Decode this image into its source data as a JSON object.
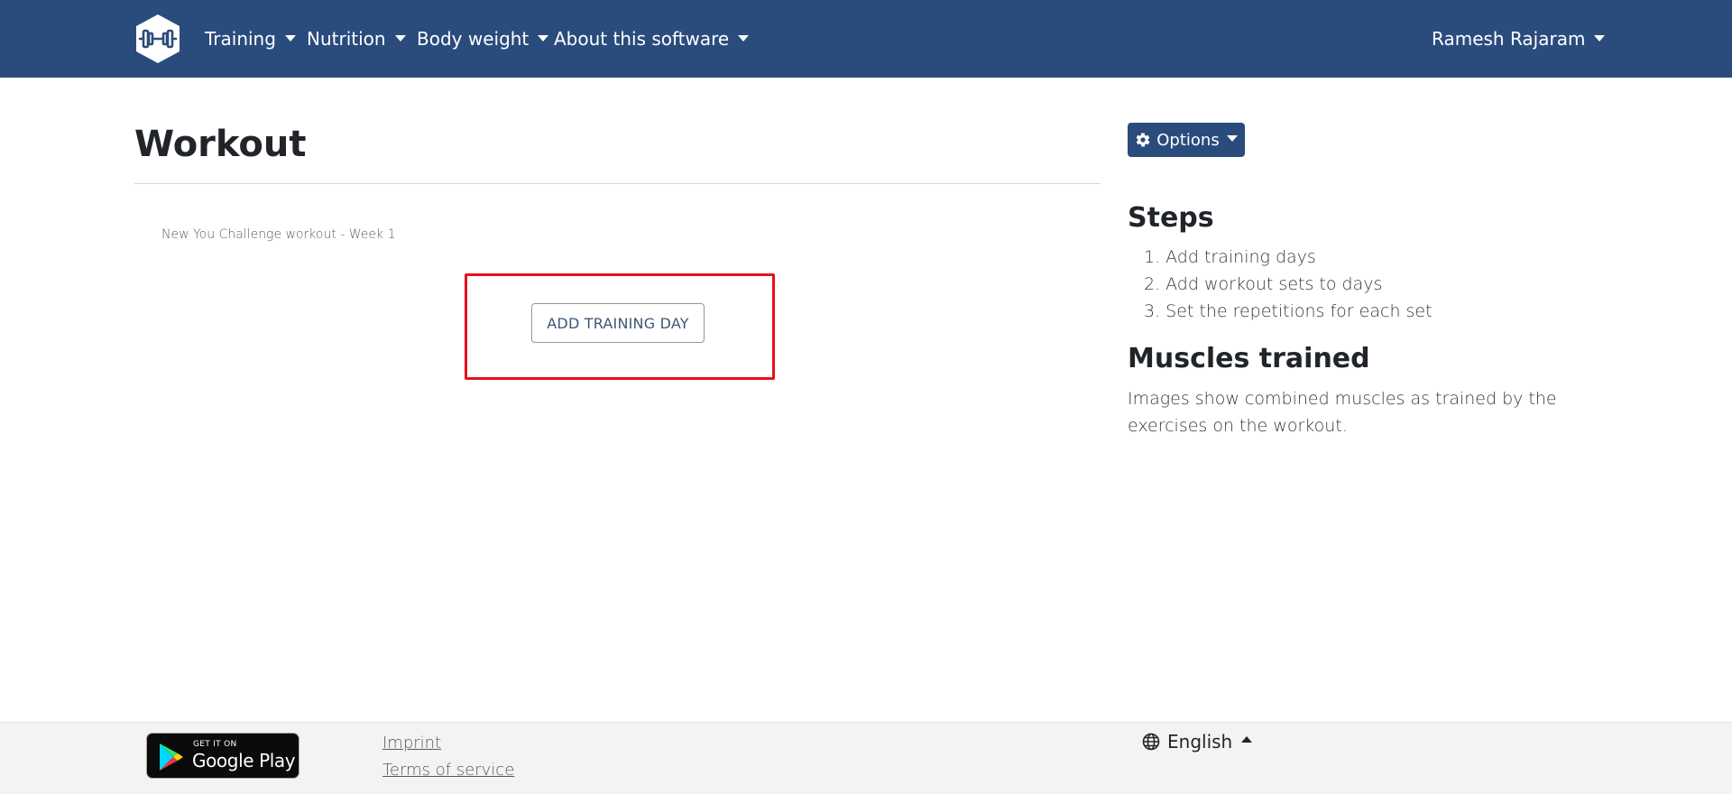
{
  "navbar": {
    "menu": [
      {
        "label": "Training"
      },
      {
        "label": "Nutrition"
      },
      {
        "label": "Body weight"
      },
      {
        "label": "About this software"
      }
    ],
    "user": "Ramesh Rajaram"
  },
  "main": {
    "title": "Workout",
    "description": "New You Challenge workout - Week 1",
    "add_day_label": "ADD TRAINING DAY"
  },
  "sidebar": {
    "options_label": "Options",
    "steps_heading": "Steps",
    "steps": [
      {
        "num": "1.",
        "text": "Add training days"
      },
      {
        "num": "2.",
        "text": "Add workout sets to days"
      },
      {
        "num": "3.",
        "text": "Set the repetitions for each set"
      }
    ],
    "muscles_heading": "Muscles trained",
    "muscles_text": "Images show combined muscles as trained by the exercises on the workout."
  },
  "footer": {
    "google_play_small": "GET IT ON",
    "google_play_big": "Google Play",
    "imprint": "Imprint",
    "terms": "Terms of service",
    "language": "English"
  },
  "colors": {
    "navbar": "#2a4c7d",
    "highlight": "#e8101c",
    "footer": "#f3f3f4"
  }
}
